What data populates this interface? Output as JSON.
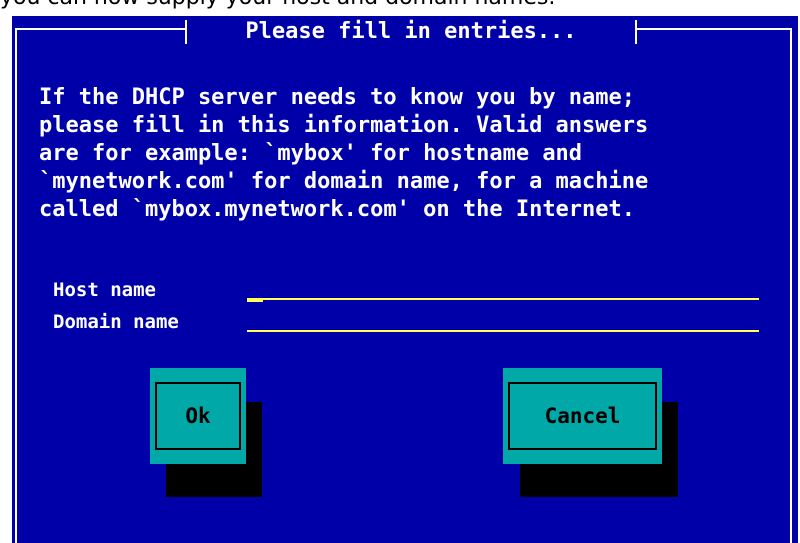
{
  "background_text": "you can now supply your host and domain names.",
  "dialog": {
    "title": "Please fill in entries...",
    "message": "If the DHCP server needs to know you by name;\nplease fill in this information. Valid answers\nare for example: `mybox' for hostname and\n`mynetwork.com' for domain name, for a machine\ncalled `mybox.mynetwork.com' on the Internet.",
    "fields": [
      {
        "label": "Host name",
        "value": ""
      },
      {
        "label": "Domain name",
        "value": ""
      }
    ],
    "buttons": {
      "ok_label": "Ok",
      "cancel_label": "Cancel"
    }
  },
  "colors": {
    "dialog_background": "#0000a8",
    "text": "#ffffff",
    "field_underline": "#ffff55",
    "button_background": "#00a8a8",
    "button_shadow": "#000000"
  }
}
